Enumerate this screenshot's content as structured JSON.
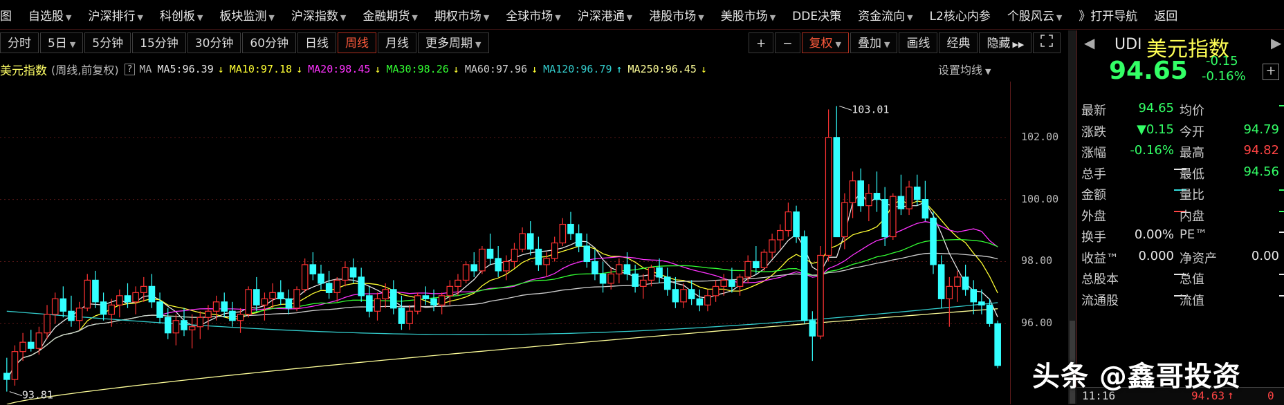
{
  "menu": [
    {
      "label": "图",
      "dd": false
    },
    {
      "label": "自选股",
      "dd": true
    },
    {
      "label": "沪深排行",
      "dd": true
    },
    {
      "label": "科创板",
      "dd": true
    },
    {
      "label": "板块监测",
      "dd": true
    },
    {
      "label": "沪深指数",
      "dd": true
    },
    {
      "label": "金融期货",
      "dd": true
    },
    {
      "label": "期权市场",
      "dd": true
    },
    {
      "label": "全球市场",
      "dd": true
    },
    {
      "label": "沪深港通",
      "dd": true
    },
    {
      "label": "港股市场",
      "dd": true
    },
    {
      "label": "美股市场",
      "dd": true
    },
    {
      "label": "DDE决策",
      "dd": false
    },
    {
      "label": "资金流向",
      "dd": true
    },
    {
      "label": "L2核心内参",
      "dd": false
    },
    {
      "label": "个股风云",
      "dd": true
    },
    {
      "label": "》打开导航",
      "dd": false
    },
    {
      "label": "返回",
      "dd": false
    }
  ],
  "periods": [
    {
      "label": "分时",
      "dd": false,
      "active": false
    },
    {
      "label": "5日",
      "dd": true,
      "active": false
    },
    {
      "label": "5分钟",
      "dd": false,
      "active": false
    },
    {
      "label": "15分钟",
      "dd": false,
      "active": false
    },
    {
      "label": "30分钟",
      "dd": false,
      "active": false
    },
    {
      "label": "60分钟",
      "dd": false,
      "active": false
    },
    {
      "label": "日线",
      "dd": false,
      "active": false
    },
    {
      "label": "周线",
      "dd": false,
      "active": true
    },
    {
      "label": "月线",
      "dd": false,
      "active": false
    },
    {
      "label": "更多周期",
      "dd": true,
      "active": false
    }
  ],
  "tools": {
    "zoom_in": "+",
    "zoom_out": "−",
    "fuquan": "复权",
    "overlay": "叠加",
    "draw": "画线",
    "classic": "经典",
    "hide": "隐藏",
    "expand_icon": "fullscreen-icon"
  },
  "ma_bar": {
    "title": "美元指数",
    "subtitle": "(周线,前复权)",
    "help": "?",
    "ma_label": "MA",
    "settings": "设置均线",
    "items": [
      {
        "text": "MA5:96.39",
        "arrow": "↓",
        "color": "#e6e6e6"
      },
      {
        "text": "MA10:97.18",
        "arrow": "↓",
        "color": "#ffff33"
      },
      {
        "text": "MA20:98.45",
        "arrow": "↓",
        "color": "#ff33ff"
      },
      {
        "text": "MA30:98.26",
        "arrow": "↓",
        "color": "#33ff33"
      },
      {
        "text": "MA60:97.96",
        "arrow": "↓",
        "color": "#d0d0d0"
      },
      {
        "text": "MA120:96.79",
        "arrow": "↑",
        "color": "#33cccc"
      },
      {
        "text": "MA250:96.45",
        "arrow": "↓",
        "color": "#ffff99"
      }
    ]
  },
  "chart_data": {
    "type": "candlestick",
    "period": "weekly",
    "yticks": [
      102.0,
      100.0,
      98.0,
      96.0
    ],
    "ylim": [
      93.4,
      103.8
    ],
    "annotations": [
      {
        "text": "103.01",
        "value": 103.01
      },
      {
        "text": "93.81",
        "value": 93.81
      }
    ],
    "candles": [
      [
        94.4,
        94.9,
        93.81,
        94.2
      ],
      [
        94.2,
        95.3,
        94.0,
        95.1
      ],
      [
        95.1,
        95.7,
        94.8,
        95.4
      ],
      [
        95.4,
        95.8,
        95.1,
        95.2
      ],
      [
        95.2,
        95.9,
        95.0,
        95.7
      ],
      [
        95.7,
        96.6,
        95.5,
        96.3
      ],
      [
        96.3,
        97.0,
        96.0,
        96.8
      ],
      [
        96.8,
        97.2,
        96.2,
        96.4
      ],
      [
        96.4,
        96.9,
        95.9,
        96.1
      ],
      [
        96.1,
        96.7,
        95.8,
        96.5
      ],
      [
        96.5,
        97.6,
        96.4,
        97.4
      ],
      [
        97.4,
        97.7,
        96.5,
        96.7
      ],
      [
        96.7,
        97.0,
        96.1,
        96.3
      ],
      [
        96.3,
        96.8,
        95.9,
        96.6
      ],
      [
        96.6,
        97.1,
        96.2,
        96.9
      ],
      [
        96.9,
        97.3,
        96.5,
        96.7
      ],
      [
        96.7,
        97.2,
        96.3,
        97.0
      ],
      [
        97.0,
        97.5,
        96.7,
        97.2
      ],
      [
        97.2,
        97.6,
        96.5,
        96.7
      ],
      [
        96.7,
        97.0,
        96.0,
        96.2
      ],
      [
        96.2,
        96.5,
        95.5,
        95.7
      ],
      [
        95.7,
        96.3,
        95.3,
        96.1
      ],
      [
        96.1,
        96.5,
        95.6,
        95.8
      ],
      [
        95.8,
        96.3,
        95.2,
        95.9
      ],
      [
        95.9,
        96.4,
        95.5,
        96.2
      ],
      [
        96.2,
        96.6,
        95.8,
        96.4
      ],
      [
        96.4,
        96.9,
        96.1,
        96.7
      ],
      [
        96.7,
        97.0,
        96.2,
        96.4
      ],
      [
        96.4,
        96.7,
        95.9,
        96.1
      ],
      [
        96.1,
        96.5,
        95.7,
        96.3
      ],
      [
        96.3,
        97.2,
        96.2,
        97.1
      ],
      [
        97.1,
        97.5,
        96.4,
        96.6
      ],
      [
        96.6,
        97.0,
        96.1,
        96.8
      ],
      [
        96.8,
        97.3,
        96.5,
        97.0
      ],
      [
        97.0,
        97.4,
        96.6,
        96.8
      ],
      [
        96.8,
        97.1,
        96.3,
        96.5
      ],
      [
        96.5,
        97.2,
        96.4,
        97.1
      ],
      [
        97.1,
        98.1,
        97.0,
        97.9
      ],
      [
        97.9,
        98.3,
        97.4,
        97.6
      ],
      [
        97.6,
        97.9,
        97.1,
        97.3
      ],
      [
        97.3,
        97.7,
        96.8,
        97.0
      ],
      [
        97.0,
        97.5,
        96.7,
        97.4
      ],
      [
        97.4,
        98.0,
        97.2,
        97.8
      ],
      [
        97.8,
        98.1,
        97.3,
        97.5
      ],
      [
        97.5,
        97.8,
        96.7,
        96.9
      ],
      [
        96.9,
        97.2,
        96.2,
        96.4
      ],
      [
        96.4,
        97.0,
        96.1,
        96.8
      ],
      [
        96.8,
        97.3,
        96.5,
        97.1
      ],
      [
        97.1,
        97.4,
        96.3,
        96.5
      ],
      [
        96.5,
        96.9,
        95.8,
        96.0
      ],
      [
        96.0,
        96.6,
        95.8,
        96.4
      ],
      [
        96.4,
        97.0,
        96.3,
        96.9
      ],
      [
        96.9,
        97.2,
        96.6,
        96.8
      ],
      [
        96.8,
        97.1,
        96.4,
        96.6
      ],
      [
        96.6,
        97.0,
        96.3,
        96.9
      ],
      [
        96.9,
        97.4,
        96.6,
        97.2
      ],
      [
        97.2,
        97.6,
        96.9,
        97.4
      ],
      [
        97.4,
        98.0,
        97.3,
        97.9
      ],
      [
        97.9,
        98.3,
        97.5,
        97.7
      ],
      [
        97.7,
        98.5,
        97.6,
        98.4
      ],
      [
        98.4,
        98.9,
        97.9,
        98.1
      ],
      [
        98.1,
        98.5,
        97.5,
        97.7
      ],
      [
        97.7,
        98.2,
        97.4,
        98.0
      ],
      [
        98.0,
        98.6,
        97.8,
        98.4
      ],
      [
        98.4,
        99.1,
        98.3,
        98.9
      ],
      [
        98.9,
        99.3,
        98.2,
        98.4
      ],
      [
        98.4,
        98.8,
        97.7,
        97.9
      ],
      [
        97.9,
        98.3,
        97.5,
        98.1
      ],
      [
        98.1,
        98.8,
        98.0,
        98.6
      ],
      [
        98.6,
        99.4,
        98.5,
        99.2
      ],
      [
        99.2,
        99.6,
        98.7,
        98.9
      ],
      [
        98.9,
        99.2,
        98.3,
        98.5
      ],
      [
        98.5,
        98.9,
        97.8,
        98.0
      ],
      [
        98.0,
        98.4,
        97.4,
        97.6
      ],
      [
        97.6,
        98.0,
        97.0,
        97.3
      ],
      [
        97.3,
        97.8,
        97.1,
        97.6
      ],
      [
        97.6,
        98.1,
        97.3,
        97.9
      ],
      [
        97.9,
        98.3,
        97.4,
        97.6
      ],
      [
        97.6,
        97.9,
        97.0,
        97.2
      ],
      [
        97.2,
        97.6,
        96.8,
        97.4
      ],
      [
        97.4,
        97.9,
        97.2,
        97.8
      ],
      [
        97.8,
        98.1,
        97.3,
        97.5
      ],
      [
        97.5,
        97.8,
        96.9,
        97.1
      ],
      [
        97.1,
        97.5,
        96.5,
        96.7
      ],
      [
        96.7,
        97.3,
        96.5,
        97.1
      ],
      [
        97.1,
        97.4,
        96.6,
        96.8
      ],
      [
        96.8,
        97.1,
        96.4,
        96.6
      ],
      [
        96.6,
        97.1,
        96.4,
        96.9
      ],
      [
        96.9,
        97.4,
        96.7,
        97.2
      ],
      [
        97.2,
        97.6,
        96.9,
        97.4
      ],
      [
        97.4,
        97.8,
        97.0,
        97.2
      ],
      [
        97.2,
        97.6,
        96.9,
        97.5
      ],
      [
        97.5,
        98.2,
        97.3,
        98.0
      ],
      [
        98.0,
        98.5,
        97.6,
        97.8
      ],
      [
        97.8,
        98.4,
        97.7,
        98.3
      ],
      [
        98.3,
        98.9,
        98.1,
        98.7
      ],
      [
        98.7,
        99.2,
        98.4,
        99.0
      ],
      [
        99.0,
        99.9,
        98.8,
        99.6
      ],
      [
        99.6,
        99.8,
        98.6,
        98.8
      ],
      [
        98.8,
        99.0,
        96.0,
        96.1
      ],
      [
        96.1,
        96.4,
        94.8,
        95.6
      ],
      [
        95.6,
        98.5,
        95.5,
        98.2
      ],
      [
        98.2,
        102.9,
        98.0,
        102.0
      ],
      [
        102.0,
        103.01,
        101.6,
        98.8
      ],
      [
        98.8,
        100.2,
        98.4,
        99.9
      ],
      [
        99.9,
        100.9,
        99.4,
        100.6
      ],
      [
        100.6,
        101.0,
        99.6,
        99.8
      ],
      [
        99.8,
        100.5,
        99.3,
        100.2
      ],
      [
        100.2,
        100.9,
        99.6,
        100.0
      ],
      [
        100.0,
        100.4,
        98.5,
        98.8
      ],
      [
        98.8,
        100.2,
        98.7,
        100.1
      ],
      [
        100.1,
        100.8,
        99.5,
        99.7
      ],
      [
        99.7,
        100.6,
        99.5,
        100.4
      ],
      [
        100.4,
        100.8,
        99.8,
        100.0
      ],
      [
        100.0,
        100.6,
        99.3,
        99.4
      ],
      [
        99.4,
        99.6,
        97.6,
        97.9
      ],
      [
        97.9,
        98.2,
        96.5,
        96.8
      ],
      [
        96.8,
        97.5,
        95.9,
        97.2
      ],
      [
        97.2,
        97.7,
        96.7,
        97.5
      ],
      [
        97.5,
        97.9,
        96.9,
        97.1
      ],
      [
        97.1,
        97.4,
        96.3,
        96.7
      ],
      [
        96.7,
        97.1,
        96.3,
        96.6
      ],
      [
        96.6,
        96.8,
        95.9,
        96.0
      ],
      [
        96.0,
        96.1,
        94.56,
        94.65
      ]
    ]
  },
  "panel": {
    "code": "UDI",
    "name": "美元指数",
    "price": "94.65",
    "change": "-0.15",
    "change_pct": "-0.16%",
    "add": "+",
    "rows": [
      {
        "l1": "最新",
        "v1": "94.65",
        "c1": "green",
        "l2": "均价",
        "v2": "—",
        "c2": "green"
      },
      {
        "l1": "涨跌",
        "v1": "▼0.15",
        "c1": "green",
        "l2": "今开",
        "v2": "94.79",
        "c2": "green"
      },
      {
        "l1": "涨幅",
        "v1": "-0.16%",
        "c1": "green",
        "l2": "最高",
        "v2": "94.82",
        "c2": "red"
      },
      {
        "l1": "总手",
        "v1": "—",
        "c1": "white",
        "l2": "最低",
        "v2": "94.56",
        "c2": "green"
      },
      {
        "l1": "金额",
        "v1": "—",
        "c1": "cyan",
        "l2": "量比",
        "v2": "—",
        "c2": "green"
      },
      {
        "l1": "外盘",
        "v1": "—",
        "c1": "red",
        "l2": "内盘",
        "v2": "—",
        "c2": "green"
      },
      {
        "l1": "换手",
        "v1": "0.00%",
        "c1": "white",
        "l2": "PE™",
        "v2": "—",
        "c2": "white"
      },
      {
        "l1": "收益™",
        "v1": "0.000",
        "c1": "white",
        "l2": "净资产",
        "v2": "0.00",
        "c2": "white"
      },
      {
        "l1": "总股本",
        "v1": "—",
        "c1": "white",
        "l2": "总值",
        "v2": "—",
        "c2": "white"
      },
      {
        "l1": "流通股",
        "v1": "—",
        "c1": "white",
        "l2": "流值",
        "v2": "—",
        "c2": "white"
      }
    ],
    "tick_time": "11:16",
    "tick_price": "94.63",
    "tick_arrow": "↑",
    "tick_vol": "0"
  },
  "watermark": "头条 @鑫哥投资"
}
